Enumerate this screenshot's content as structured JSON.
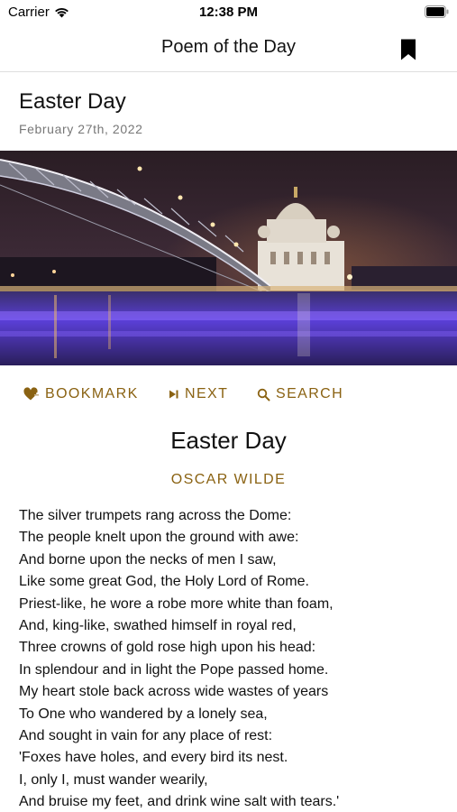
{
  "status_bar": {
    "carrier": "Carrier",
    "time": "12:38 PM",
    "icons": [
      "wifi-icon",
      "battery-icon"
    ]
  },
  "nav": {
    "title": "Poem of the Day",
    "bookmark_icon": "bookmark-icon"
  },
  "header": {
    "title": "Easter Day",
    "date": "February 27th, 2022"
  },
  "hero_image": {
    "icon": "photo-night-cathedral-bridge"
  },
  "actions": [
    {
      "label": "BOOKMARK",
      "icon": "heart-plus-icon"
    },
    {
      "label": "NEXT",
      "icon": "skip-next-icon"
    },
    {
      "label": "SEARCH",
      "icon": "search-icon"
    }
  ],
  "poem": {
    "title": "Easter Day",
    "author": "OSCAR WILDE",
    "lines": [
      "The silver trumpets rang across the Dome:",
      "The people knelt upon the ground with awe:",
      "And borne upon the necks of men I saw,",
      "Like some great God, the Holy Lord of Rome.",
      "Priest-like, he wore a robe more white than foam,",
      "And, king-like, swathed himself in royal red,",
      "Three crowns of gold rose high upon his head:",
      "In splendour and in light the Pope passed home.",
      "My heart stole back across wide wastes of years",
      "To One who wandered by a lonely sea,",
      "And sought in vain for any place of rest:",
      "'Foxes have holes, and every bird its nest.",
      "I, only I, must wander wearily,",
      "And bruise my feet, and drink wine salt with tears.'"
    ]
  },
  "colors": {
    "accent": "#8a6212",
    "text": "#111111",
    "muted": "#777777",
    "divider": "#dedede"
  }
}
